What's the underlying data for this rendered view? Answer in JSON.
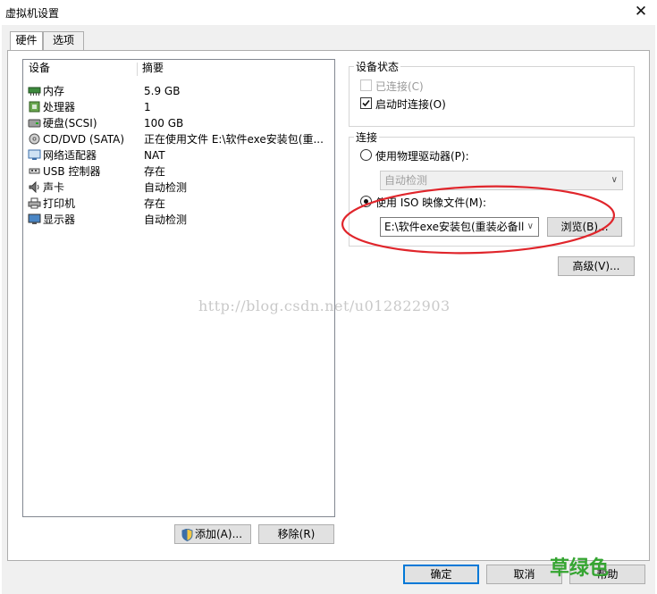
{
  "window": {
    "title": "虚拟机设置",
    "close_glyph": "✕"
  },
  "tabs": [
    {
      "label": "硬件"
    },
    {
      "label": "选项"
    }
  ],
  "device_list": {
    "headers": {
      "device": "设备",
      "summary": "摘要"
    },
    "rows": [
      {
        "name": "内存",
        "summary": "5.9 GB",
        "icon": "memory-icon"
      },
      {
        "name": "处理器",
        "summary": "1",
        "icon": "processor-icon"
      },
      {
        "name": "硬盘(SCSI)",
        "summary": "100 GB",
        "icon": "harddisk-icon"
      },
      {
        "name": "CD/DVD (SATA)",
        "summary": "正在使用文件 E:\\软件exe安装包(重...",
        "icon": "cd-dvd-icon"
      },
      {
        "name": "网络适配器",
        "summary": "NAT",
        "icon": "network-adapter-icon"
      },
      {
        "name": "USB 控制器",
        "summary": "存在",
        "icon": "usb-icon"
      },
      {
        "name": "声卡",
        "summary": "自动检测",
        "icon": "sound-card-icon"
      },
      {
        "name": "打印机",
        "summary": "存在",
        "icon": "printer-icon"
      },
      {
        "name": "显示器",
        "summary": "自动检测",
        "icon": "display-icon"
      }
    ]
  },
  "list_buttons": {
    "add": "添加(A)...",
    "remove": "移除(R)"
  },
  "device_status": {
    "title": "设备状态",
    "connected": {
      "label": "已连接(C)",
      "checked": false,
      "disabled": true
    },
    "connect_at_power_on": {
      "label": "启动时连接(O)",
      "checked": true
    }
  },
  "connection": {
    "title": "连接",
    "physical": {
      "label": "使用物理驱动器(P):",
      "selected": false,
      "drive_value": "自动检测"
    },
    "iso": {
      "label": "使用 ISO 映像文件(M):",
      "selected": true,
      "path_value": "E:\\软件exe安装包(重装必备ll"
    },
    "browse": "浏览(B)..."
  },
  "advanced": "高级(V)...",
  "footer": {
    "ok": "确定",
    "cancel": "取消",
    "help": "帮助"
  },
  "watermark": "http://blog.csdn.net/u012822903",
  "brand_mark": "草绿色",
  "colors": {
    "annotation_circle": "#e0252b",
    "brand_green": "#35a531",
    "ok_border": "#0078d7"
  }
}
